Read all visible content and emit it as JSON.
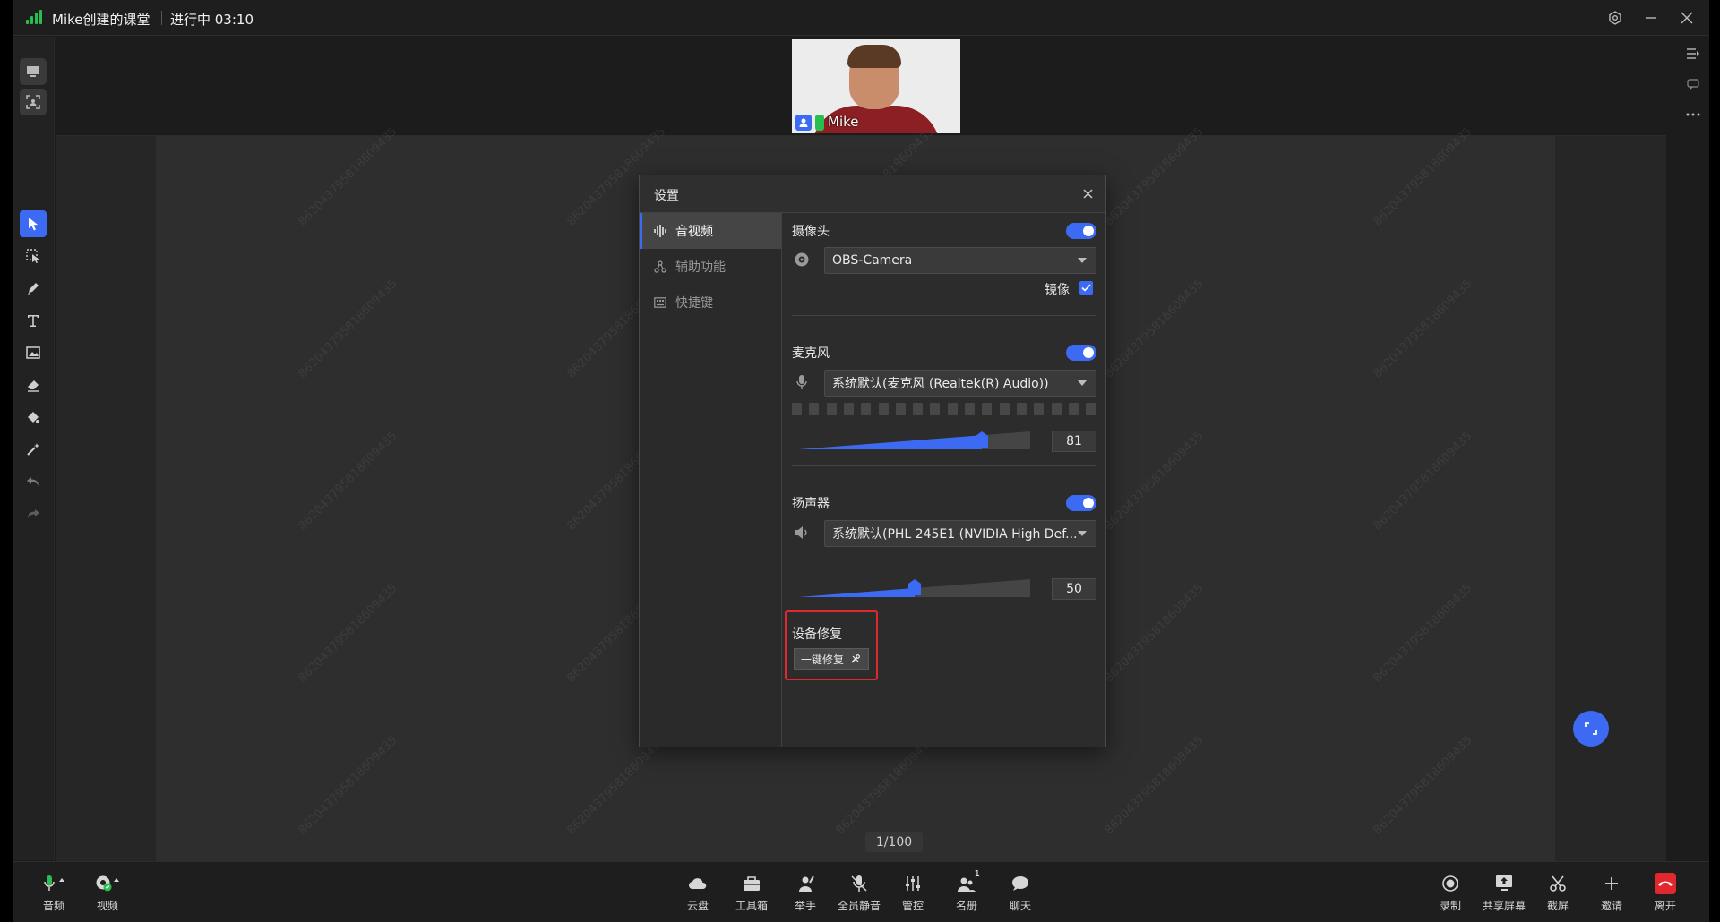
{
  "titlebar": {
    "title": "Mike创建的课堂",
    "status": "进行中 03:10"
  },
  "camera": {
    "name": "Mike"
  },
  "watermark": "862043795818609435",
  "dialog": {
    "title": "设置",
    "nav": [
      {
        "label": "音视频",
        "icon": "audio-wave-icon"
      },
      {
        "label": "辅助功能",
        "icon": "accessibility-icon"
      },
      {
        "label": "快捷键",
        "icon": "keyboard-icon"
      }
    ],
    "camera": {
      "label": "摄像头",
      "device": "OBS-Camera",
      "mirror_label": "镜像",
      "enabled": true,
      "mirror": true
    },
    "microphone": {
      "label": "麦克风",
      "device": "系统默认(麦克风 (Realtek(R) Audio))",
      "volume": "81",
      "enabled": true
    },
    "speaker": {
      "label": "扬声器",
      "device": "系统默认(PHL 245E1 (NVIDIA High Def...",
      "volume": "50",
      "enabled": true
    },
    "repair": {
      "label": "设备修复",
      "button": "一键修复"
    }
  },
  "page_indicator": "1/100",
  "bottom": {
    "left": [
      {
        "label": "音频"
      },
      {
        "label": "视频"
      }
    ],
    "center": [
      {
        "label": "云盘"
      },
      {
        "label": "工具箱"
      },
      {
        "label": "举手"
      },
      {
        "label": "全员静音"
      },
      {
        "label": "管控"
      },
      {
        "label": "名册",
        "badge": "1"
      },
      {
        "label": "聊天"
      }
    ],
    "right": [
      {
        "label": "录制"
      },
      {
        "label": "共享屏幕"
      },
      {
        "label": "截屏"
      },
      {
        "label": "邀请"
      },
      {
        "label": "离开"
      }
    ]
  },
  "colors": {
    "accent": "#3d6af2",
    "danger": "#e0282e",
    "signal": "#27c04f"
  }
}
